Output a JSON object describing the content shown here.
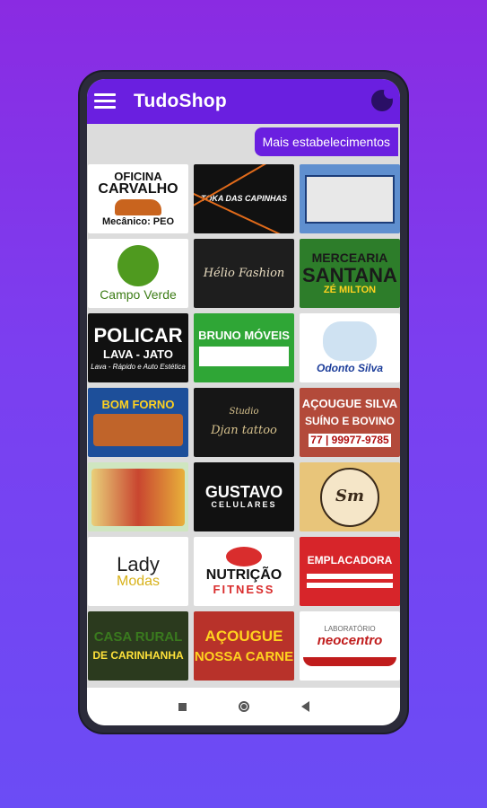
{
  "app": {
    "title": "TudoShop",
    "more_button": "Mais estabelecimentos"
  },
  "icons": {
    "menu": "hamburger-menu-icon",
    "theme": "dark-mode-moon-icon"
  },
  "stores": [
    {
      "l1": "OFICINA",
      "l2": "CARVALHO",
      "l3": "Mecânico: PEO"
    },
    {
      "l1": "TOKA DAS CAPINHAS",
      "l2": "",
      "l3": ""
    },
    {
      "l1": "",
      "l2": "",
      "l3": ""
    },
    {
      "l1": "Campo Verde",
      "l2": "",
      "l3": ""
    },
    {
      "l1": "Hélio Fashion",
      "l2": "",
      "l3": ""
    },
    {
      "l1": "MERCEARIA",
      "l2": "SANTANA",
      "l3": "ZÉ MILTON"
    },
    {
      "l1": "POLICAR",
      "l2": "LAVA - JATO",
      "l3": "Lava - Rápido e Auto Estética"
    },
    {
      "l1": "BRUNO MÓVEIS",
      "l2": "",
      "l3": ""
    },
    {
      "l1": "Odonto Silva",
      "l2": "",
      "l3": ""
    },
    {
      "l1": "BOM FORNO",
      "l2": "",
      "l3": ""
    },
    {
      "l1": "Studio",
      "l2": "Djan tattoo",
      "l3": ""
    },
    {
      "l1": "AÇOUGUE SILVA",
      "l2": "SUÍNO E BOVINO",
      "l3": "77 | 99977-9785"
    },
    {
      "l1": "",
      "l2": "",
      "l3": ""
    },
    {
      "l1": "GUSTAVO",
      "l2": "CELULARES",
      "l3": ""
    },
    {
      "l1": "Sm",
      "l2": "",
      "l3": ""
    },
    {
      "l1": "Lady",
      "l2": "Modas",
      "l3": ""
    },
    {
      "l1": "NUTRIÇÃO",
      "l2": "FITNESS",
      "l3": ""
    },
    {
      "l1": "EMPLACADORA",
      "l2": "",
      "l3": ""
    },
    {
      "l1": "CASA RURAL",
      "l2": "DE CARINHANHA",
      "l3": ""
    },
    {
      "l1": "AÇOUGUE",
      "l2": "NOSSA CARNE",
      "l3": ""
    },
    {
      "l1": "LABORATÓRIO",
      "l2": "neocentro",
      "l3": ""
    }
  ],
  "colors": {
    "accent": "#6a1fe0",
    "background_top": "#8a2be2"
  }
}
